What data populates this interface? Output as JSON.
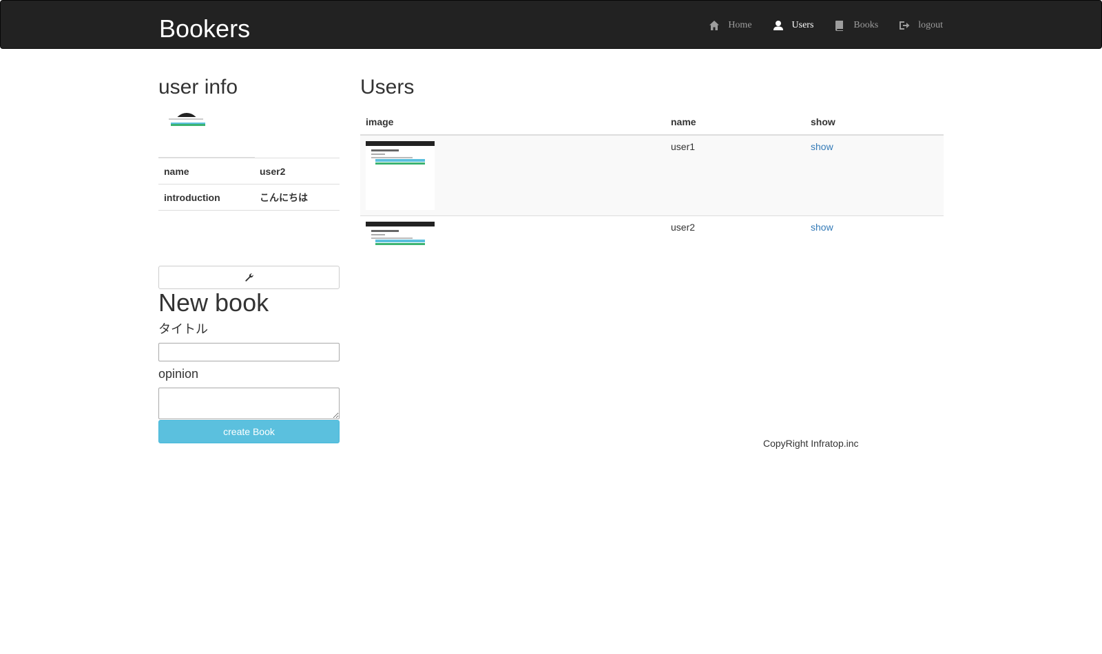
{
  "navbar": {
    "brand": "Bookers",
    "items": [
      {
        "label": "Home",
        "icon": "home-icon"
      },
      {
        "label": "Users",
        "icon": "user-icon",
        "active": true
      },
      {
        "label": "Books",
        "icon": "book-icon"
      },
      {
        "label": "logout",
        "icon": "logout-icon"
      }
    ]
  },
  "sidebar": {
    "title": "user info",
    "info": [
      {
        "key": "name",
        "value": "user2"
      },
      {
        "key": "introduction",
        "value": "こんにちは"
      }
    ],
    "edit_icon": "wrench-icon",
    "new_book": {
      "title": "New book",
      "title_label": "タイトル",
      "title_value": "",
      "opinion_label": "opinion",
      "opinion_value": "",
      "submit_label": "create Book"
    }
  },
  "main": {
    "title": "Users",
    "columns": [
      "image",
      "name",
      "show"
    ],
    "rows": [
      {
        "name": "user1",
        "show": "show"
      },
      {
        "name": "user2",
        "show": "show"
      }
    ]
  },
  "footer": {
    "text": "CopyRight Infratop.inc"
  },
  "colors": {
    "navbar_bg": "#222222",
    "info_button": "#5bc0de",
    "link": "#337ab7"
  }
}
